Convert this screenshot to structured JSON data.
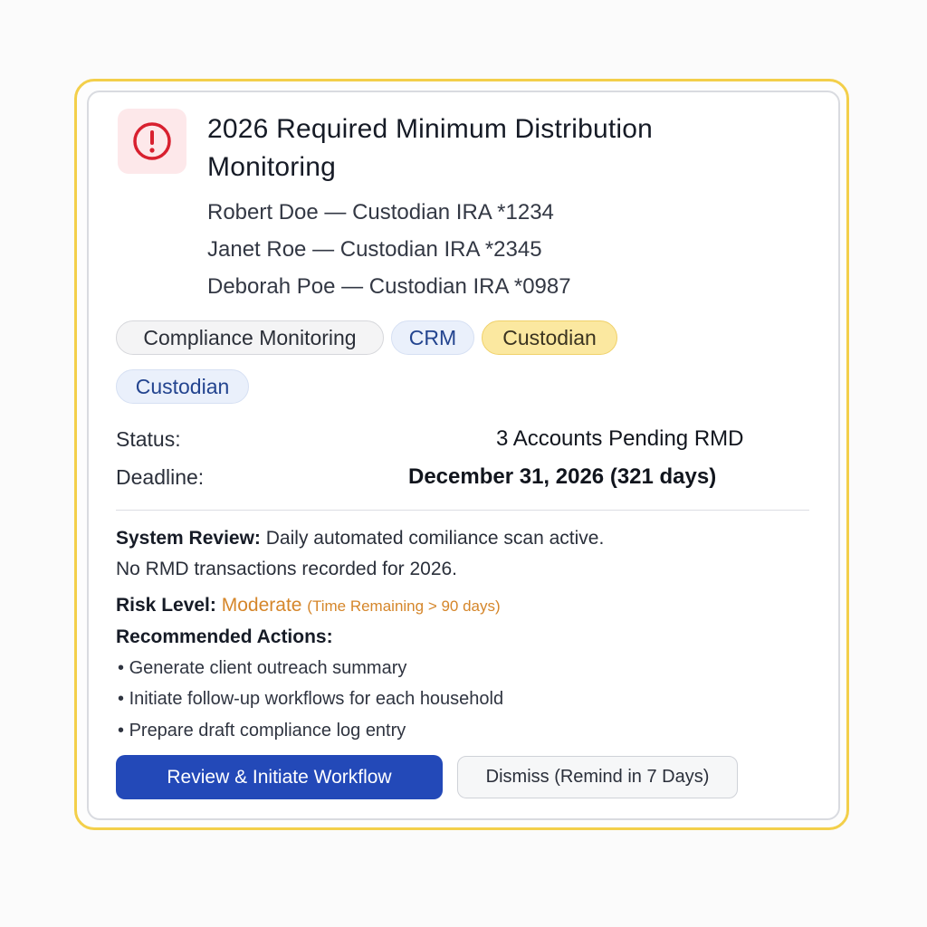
{
  "card": {
    "title": "2026 Required Minimum Distribution Monitoring",
    "alert_icon": "alert-circle-icon",
    "accounts": [
      "Robert Doe — Custodian IRA *1234",
      "Janet Roe — Custodian IRA *2345",
      "Deborah Poe — Custodian IRA *0987"
    ],
    "tags": [
      {
        "label": "Compliance Monitoring",
        "color": "#f4f4f5"
      },
      {
        "label": "CRM",
        "color": "#eaf0fb"
      },
      {
        "label": "Custodian",
        "color": "#fbe8a0"
      },
      {
        "label": "Custodian",
        "color": "#eaf0fb"
      }
    ],
    "status_label": "Status:",
    "status_value": "3 Accounts Pending RMD",
    "deadline_label": "Deadline:",
    "deadline_value": "December 31, 2026 (321 days)",
    "system_review_label": "System Review:",
    "system_review_text": "Daily automated comiliance scan active.",
    "system_review_note": "No RMD transactions recorded for 2026.",
    "risk_label": "Risk Level:",
    "risk_value": "Moderate",
    "risk_note": "(Time Remaining > 90 days)",
    "actions_heading": "Recommended Actions:",
    "actions": [
      "Generate client outreach summary",
      "Initiate follow-up workflows for each household",
      "Prepare draft compliance log entry"
    ],
    "primary_button": "Review & Initiate Workflow",
    "secondary_button": "Dismiss (Remind in 7 Days)"
  },
  "colors": {
    "outer_border": "#f3cf4a",
    "alert_red": "#d8202f",
    "risk_moderate": "#d5862a",
    "primary_button": "#2349b8"
  }
}
